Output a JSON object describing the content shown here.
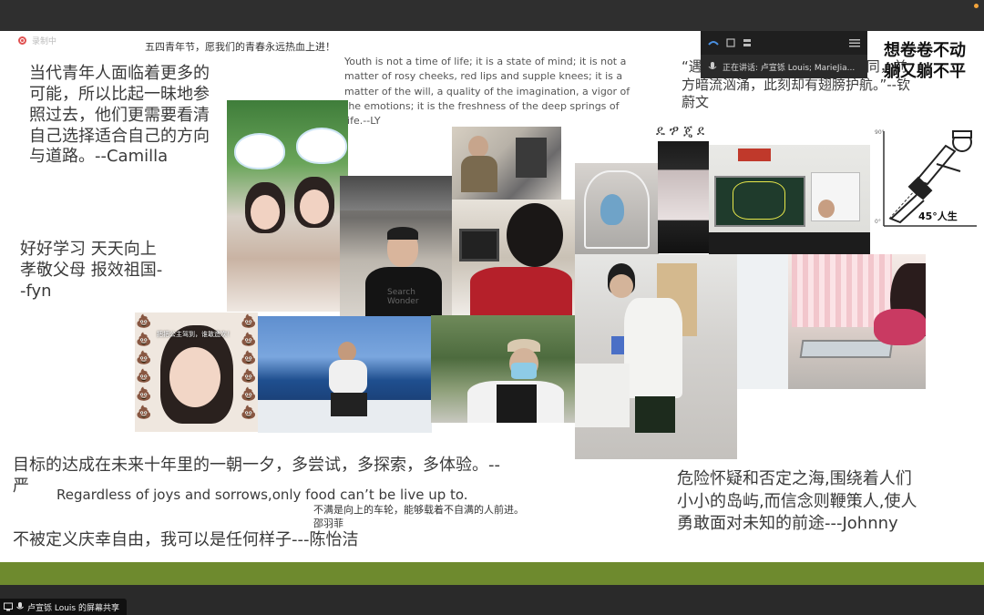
{
  "app": {
    "recording_label": "录制中",
    "screen_share_label": "卢宣铄 Louis 的屏幕共享",
    "speaking_panel": {
      "speaking_text": "正在讲话: 卢宣铄 Louis; MarieJia..."
    }
  },
  "slide": {
    "header_note": "五四青年节，愿我们的青春永远热血上进！",
    "quote_camilla": "当代青年人面临着更多的\n可能，所以比起一昧地参\n照过去，他们更需要看清\n自己选择适合自己的方向\n与道路。--Camilla",
    "quote_youth_en": "Youth is not a time of life; it is a state of mind; it is not a\nmatter of rosy cheeks, red lips and supple knees; it is a\nmatter of the will, a quality of the imagination, a vigor of\nthe emotions; it is the freshness of the deep springs of\nlife.--LY",
    "quote_weiwen": "“遇再大风浪，身畔仍有生灵一同，前\n方暗流汹涌，此刻却有翅膀护航。”--钦\n蔚文",
    "meme_title": "想卷卷不动\n躺又躺不平",
    "meme_caption": "45°人生",
    "meme_axis_top": "90°",
    "meme_axis_bottom": "0°",
    "symbols": "ዴ ፇ ጄ ደ",
    "quote_fyn": "好好学习 天天向上\n孝敬父母 报效祖国-\n-fyn",
    "photo_caption_princess": "把把公主驾到，谁敢造次！",
    "photo_shirt_text": "Search\nWonder",
    "quote_yan": "目标的达成在未来十年里的一朝一夕，多尝试，多探索，多体验。--\n严",
    "quote_food": "Regardless of joys and sorrows,only food can’t be live up to.",
    "quote_shao": "不满是向上的车轮，能够载着不自满的人前进。\n邵羽菲",
    "quote_chen": "不被定义庆幸自由，我可以是任何样子---陈怡洁",
    "quote_johnny": "危险怀疑和否定之海,围绕着人们\n小小的岛屿,而信念则鞭策人,使人\n勇敢面对未知的前途---Johnny"
  },
  "colors": {
    "accent_green": "#6e8a2e",
    "top_bar": "#2f2f2f",
    "recording_red": "#e05252"
  }
}
